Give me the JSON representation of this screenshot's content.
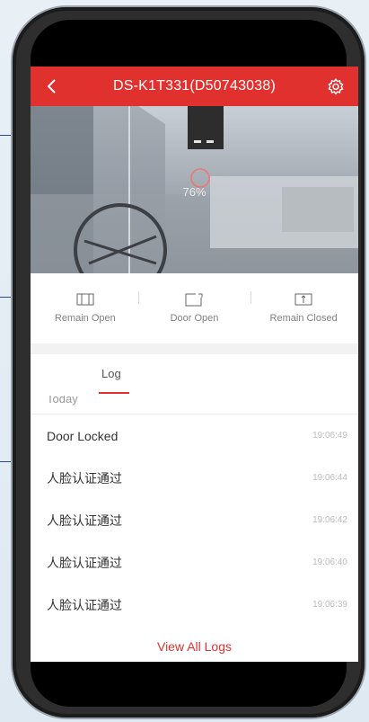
{
  "device_title": "DS-K1T331(D50743038)",
  "video": {
    "loading_percent_text": "76%",
    "loading_progress": 0.76
  },
  "controls": [
    {
      "label": "Remain Open"
    },
    {
      "label": "Door Open"
    },
    {
      "label": "Remain Closed"
    }
  ],
  "tabs": {
    "log": "Log"
  },
  "log": {
    "day_label": "Today",
    "entries": [
      {
        "event": "Door Locked",
        "time": "19:06:49"
      },
      {
        "event": "人脸认证通过",
        "time": "19:06:44"
      },
      {
        "event": "人脸认证通过",
        "time": "19:06:42"
      },
      {
        "event": "人脸认证通过",
        "time": "19:06:40"
      },
      {
        "event": "人脸认证通过",
        "time": "19:06:39"
      }
    ],
    "view_all": "View All Logs"
  },
  "colors": {
    "accent": "#e0312f",
    "text": "#333333",
    "muted": "#808080"
  }
}
